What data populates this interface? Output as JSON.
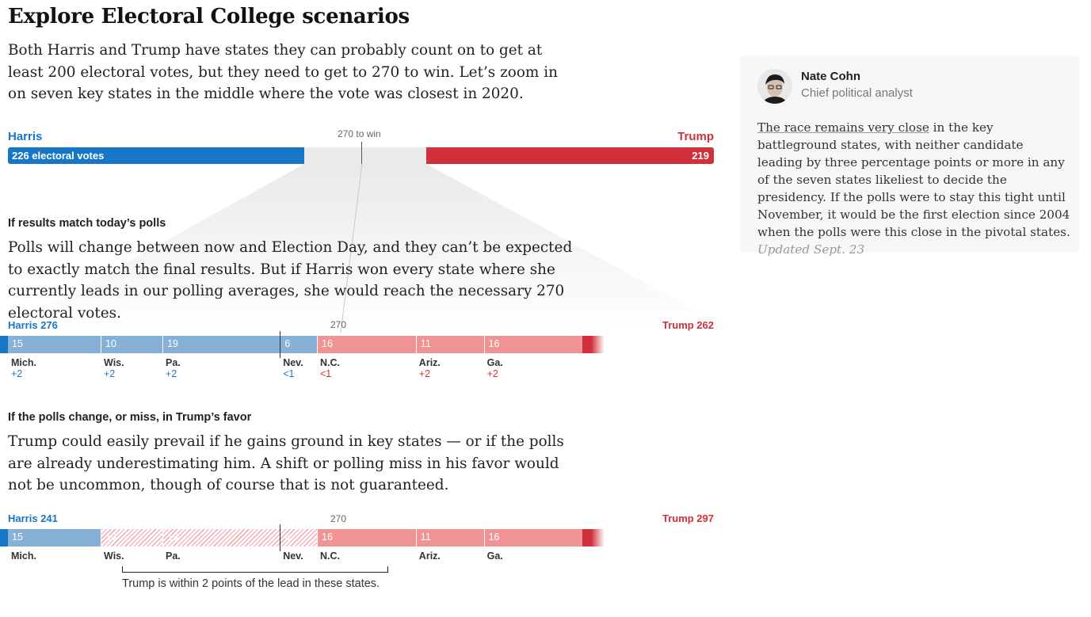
{
  "page": {
    "title": "Explore Electoral College scenarios",
    "intro": "Both Harris and Trump have states they can probably count on to get at least 200 electoral votes, but they need to get to 270 to win. Let’s zoom in on seven key states in the middle where the vote was closest in 2020."
  },
  "overview": {
    "harris_label": "Harris",
    "trump_label": "Trump",
    "threshold_label": "270 to win",
    "harris_votes_label": "226 electoral votes",
    "trump_votes_label": "219"
  },
  "scenario_polls": {
    "heading": "If results match today’s polls",
    "text": "Polls will change between now and Election Day, and they can’t be expected to exactly match the final results. But if Harris won every state where she currently leads in our polling averages, she would reach the necessary 270 electoral votes.",
    "harris_total": "Harris 276",
    "trump_total": "Trump 262",
    "threshold": "270"
  },
  "scenario_shift": {
    "heading": "If the polls change, or miss, in Trump’s favor",
    "text": "Trump could easily prevail if he gains ground in key states — or if the polls are already underestimating him. A shift or polling miss in his favor would not be uncommon, though of course that is not guaranteed.",
    "harris_total": "Harris 241",
    "trump_total": "Trump 297",
    "threshold": "270",
    "bracket_note": "Trump is within 2 points of the lead in these states."
  },
  "aside": {
    "author_name": "Nate Cohn",
    "author_title": "Chief political analyst",
    "body_link": "The race remains very close",
    "body_rest": " in the key battleground states, with neither candidate leading by three percentage points or more in any of the seven states likeliest to decide the presidency. If the polls were to stay this tight until November, it would be the first election since 2004 when the polls were this close in the pivotal states.",
    "updated": "Updated Sept. 23"
  },
  "colors": {
    "harris": "#1877c4",
    "harris_light": "#86b0d5",
    "trump": "#d0303a",
    "trump_light": "#f09394",
    "neutral": "#ebebeb"
  },
  "chart_data": [
    {
      "type": "bar",
      "title": "",
      "series": [
        {
          "name": "Harris",
          "values": [
            226
          ]
        },
        {
          "name": "Trump",
          "values": [
            219
          ]
        }
      ],
      "total": 538,
      "threshold": 270
    },
    {
      "type": "bar",
      "title": "If results match today’s polls",
      "base_harris": 226,
      "base_trump": 219,
      "states": [
        {
          "name": "Mich.",
          "ev": 15,
          "leader": "harris",
          "margin": "+2"
        },
        {
          "name": "Wis.",
          "ev": 10,
          "leader": "harris",
          "margin": "+2"
        },
        {
          "name": "Pa.",
          "ev": 19,
          "leader": "harris",
          "margin": "+2"
        },
        {
          "name": "Nev.",
          "ev": 6,
          "leader": "harris",
          "margin": "<1"
        },
        {
          "name": "N.C.",
          "ev": 16,
          "leader": "trump",
          "margin": "<1"
        },
        {
          "name": "Ariz.",
          "ev": 11,
          "leader": "trump",
          "margin": "+2"
        },
        {
          "name": "Ga.",
          "ev": 16,
          "leader": "trump",
          "margin": "+2"
        }
      ],
      "threshold": 270
    },
    {
      "type": "bar",
      "title": "If the polls change, or miss, in Trump’s favor",
      "base_harris": 226,
      "base_trump": 219,
      "states": [
        {
          "name": "Mich.",
          "ev": 15,
          "leader": "harris"
        },
        {
          "name": "Wis.",
          "ev": 10,
          "leader": "trump",
          "flipped": true
        },
        {
          "name": "Pa.",
          "ev": 19,
          "leader": "trump",
          "flipped": true
        },
        {
          "name": "Nev.",
          "ev": 6,
          "leader": "trump",
          "flipped": true
        },
        {
          "name": "N.C.",
          "ev": 16,
          "leader": "trump"
        },
        {
          "name": "Ariz.",
          "ev": 11,
          "leader": "trump"
        },
        {
          "name": "Ga.",
          "ev": 16,
          "leader": "trump"
        }
      ],
      "threshold": 270
    }
  ]
}
